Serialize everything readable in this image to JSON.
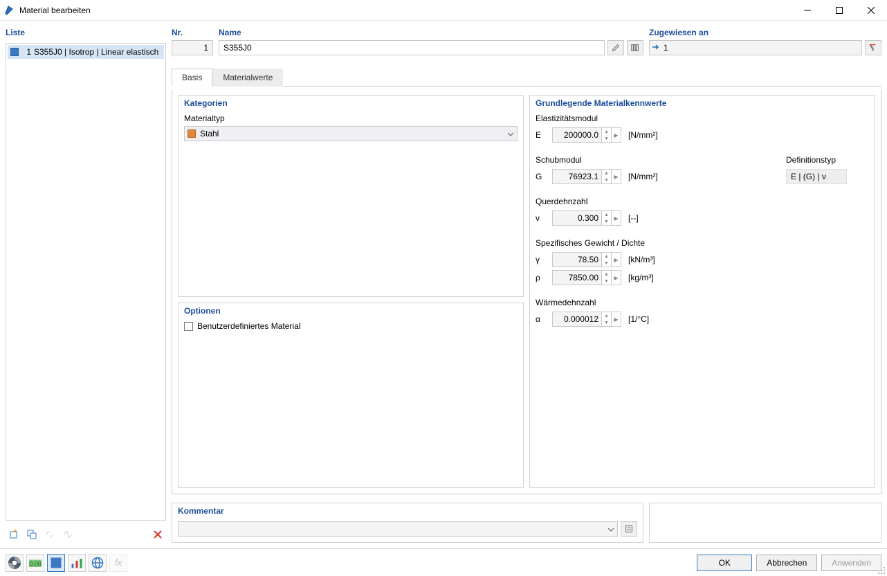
{
  "window": {
    "title": "Material bearbeiten"
  },
  "leftPanel": {
    "label": "Liste",
    "item_num": "1",
    "item_text": "S355J0 | Isotrop | Linear elastisch"
  },
  "header": {
    "nr_label": "Nr.",
    "nr_value": "1",
    "name_label": "Name",
    "name_value": "S355J0",
    "assigned_label": "Zugewiesen an",
    "assigned_value": "1"
  },
  "tabs": {
    "basis": "Basis",
    "materialwerte": "Materialwerte"
  },
  "categories": {
    "group_label": "Kategorien",
    "materialtyp_label": "Materialtyp",
    "materialtyp_value": "Stahl"
  },
  "options": {
    "group_label": "Optionen",
    "userdef_label": "Benutzerdefiniertes Material"
  },
  "props": {
    "group_label": "Grundlegende Materialkennwerte",
    "e_label": "Elastizitätsmodul",
    "e_sym": "E",
    "e_val": "200000.0",
    "e_unit": "[N/mm²]",
    "g_label": "Schubmodul",
    "g_sym": "G",
    "g_val": "76923.1",
    "g_unit": "[N/mm²]",
    "nu_label": "Querdehnzahl",
    "nu_sym": "ν",
    "nu_val": "0.300",
    "nu_unit": "[--]",
    "gamma_label": "Spezifisches Gewicht / Dichte",
    "gamma_sym": "γ",
    "gamma_val": "78.50",
    "gamma_unit": "[kN/m³]",
    "rho_sym": "ρ",
    "rho_val": "7850.00",
    "rho_unit": "[kg/m³]",
    "alpha_label": "Wärmedehnzahl",
    "alpha_sym": "α",
    "alpha_val": "0.000012",
    "alpha_unit": "[1/°C]",
    "deftyp_label": "Definitionstyp",
    "deftyp_value": "E | (G) | ν"
  },
  "comment": {
    "label": "Kommentar"
  },
  "buttons": {
    "ok": "OK",
    "cancel": "Abbrechen",
    "apply": "Anwenden"
  }
}
